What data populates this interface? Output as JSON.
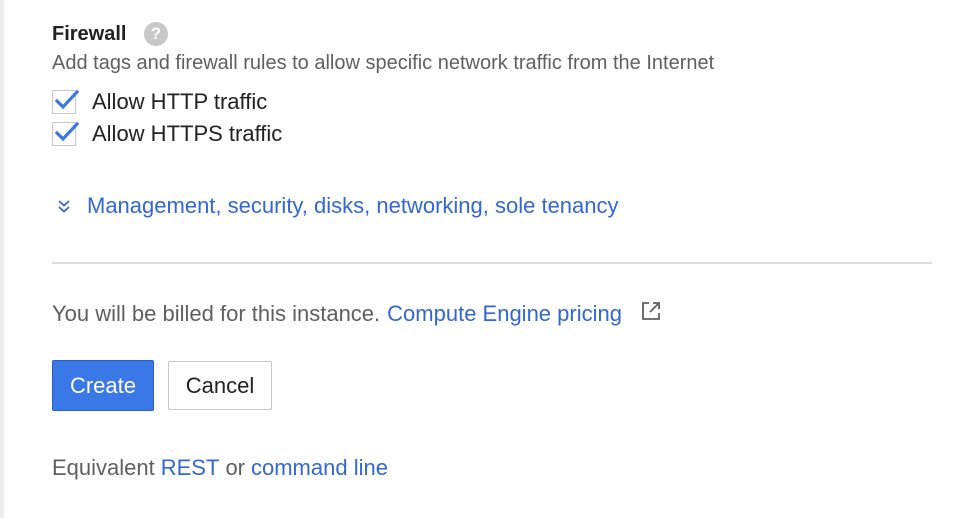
{
  "firewall": {
    "title": "Firewall",
    "help_icon": "?",
    "description": "Add tags and firewall rules to allow specific network traffic from the Internet",
    "options": [
      {
        "label": "Allow HTTP traffic",
        "checked": true
      },
      {
        "label": "Allow HTTPS traffic",
        "checked": true
      }
    ]
  },
  "expand": {
    "icon": "double-chevron-down-icon",
    "label": "Management, security, disks, networking, sole tenancy"
  },
  "billing": {
    "text": "You will be billed for this instance.",
    "link": "Compute Engine pricing",
    "icon": "external-link-icon"
  },
  "actions": {
    "create_label": "Create",
    "cancel_label": "Cancel"
  },
  "equivalent": {
    "prefix": "Equivalent",
    "rest_link": "REST",
    "or_text": "or",
    "command_line_link": "command line"
  },
  "colors": {
    "link": "#3367d6",
    "primary_button": "#3b78e7",
    "checkbox_check": "#3b78e7"
  }
}
